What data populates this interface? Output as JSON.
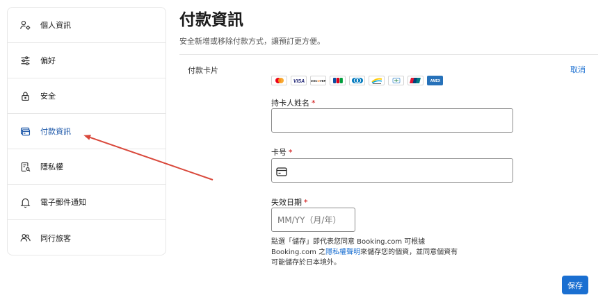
{
  "sidebar": {
    "items": [
      {
        "label": "個人資訊",
        "icon": "person-settings-icon",
        "active": false
      },
      {
        "label": "偏好",
        "icon": "sliders-icon",
        "active": false
      },
      {
        "label": "安全",
        "icon": "lock-icon",
        "active": false
      },
      {
        "label": "付款資訊",
        "icon": "credit-card-icon",
        "active": true
      },
      {
        "label": "隱私權",
        "icon": "privacy-icon",
        "active": false
      },
      {
        "label": "電子郵件通知",
        "icon": "bell-icon",
        "active": false
      },
      {
        "label": "同行旅客",
        "icon": "people-icon",
        "active": false
      }
    ]
  },
  "main": {
    "title": "付款資訊",
    "subtitle": "安全新增或移除付款方式，讓預訂更方便。",
    "section_label": "付款卡片",
    "cancel_label": "取消",
    "card_brands": [
      "Mastercard",
      "VISA",
      "DISCOVER",
      "JCB",
      "Diners Club",
      "Elo",
      "UnionPay",
      "Cartes Bancaires",
      "AMEX"
    ],
    "cardholder": {
      "label": "持卡人姓名",
      "required_mark": "*",
      "value": ""
    },
    "card_number": {
      "label": "卡号",
      "required_mark": "*",
      "value": ""
    },
    "expiry": {
      "label": "失效日期",
      "required_mark": "*",
      "placeholder": "MM/YY（月/年）",
      "value": ""
    },
    "legal": {
      "line_prefix": "點選「儲存」即代表您同意 Booking.com 可根據 Booking.com 之",
      "link_text": "隱私權聲明",
      "line_suffix": "來儲存您的個資，並同意個資有可能儲存於日本境外。"
    },
    "save_label": "保存"
  },
  "colors": {
    "accent": "#1a6fd1",
    "active_text": "#1a56a8",
    "arrow": "#d9483b",
    "required": "#cc0000"
  }
}
